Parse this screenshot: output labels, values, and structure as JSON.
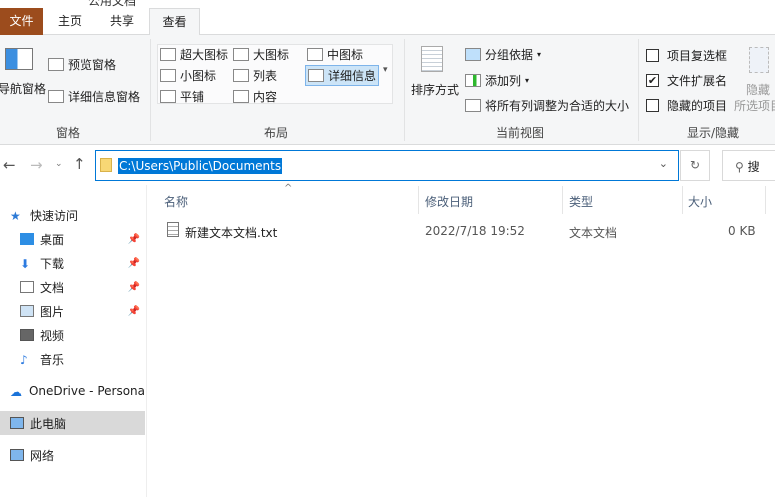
{
  "window": {
    "title": "公用文档"
  },
  "tabs": {
    "file": "文件",
    "home": "主页",
    "share": "共享",
    "view": "查看"
  },
  "ribbon": {
    "panes": {
      "nav_pane": "导航窗格",
      "preview": "预览窗格",
      "details": "详细信息窗格",
      "group": "窗格"
    },
    "layout": {
      "items": [
        "超大图标",
        "大图标",
        "中图标",
        "小图标",
        "列表",
        "详细信息",
        "平铺",
        "内容"
      ],
      "selected": "详细信息",
      "group": "布局"
    },
    "current_view": {
      "sort": "排序方式",
      "group_by": "分组依据",
      "add_col": "添加列",
      "fit_cols": "将所有列调整为合适的大小",
      "group": "当前视图"
    },
    "show_hide": {
      "item_checkboxes": "项目复选框",
      "item_checkboxes_checked": false,
      "extensions": "文件扩展名",
      "extensions_checked": true,
      "hidden_items": "隐藏的项目",
      "hidden_checked": false,
      "hide": "隐藏",
      "hide2": "所选项目",
      "group": "显示/隐藏"
    }
  },
  "address": {
    "path": "C:\\Users\\Public\\Documents",
    "search_placeholder": "搜"
  },
  "nav": {
    "quick": "快速访问",
    "desktop": "桌面",
    "downloads": "下载",
    "documents": "文档",
    "pictures": "图片",
    "videos": "视频",
    "music": "音乐",
    "onedrive": "OneDrive - Persona",
    "thispc": "此电脑",
    "network": "网络"
  },
  "columns": {
    "name": "名称",
    "date": "修改日期",
    "type": "类型",
    "size": "大小"
  },
  "files": [
    {
      "name": "新建文本文档.txt",
      "date": "2022/7/18 19:52",
      "type": "文本文档",
      "size": "0 KB"
    }
  ],
  "colors": {
    "accent": "#0078d7",
    "file_tab": "#9c4c1d"
  }
}
